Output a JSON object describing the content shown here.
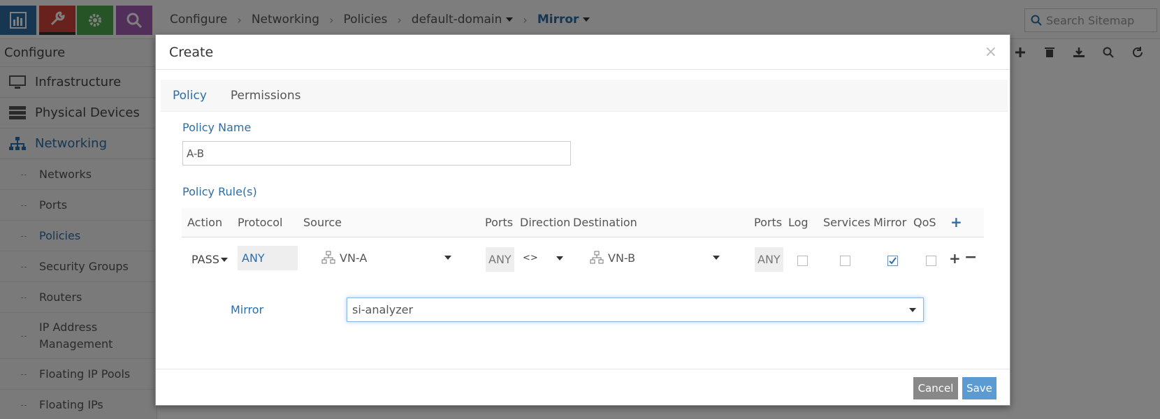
{
  "breadcrumb": {
    "items": [
      "Configure",
      "Networking",
      "Policies"
    ],
    "domain": "default-domain",
    "current": "Mirror"
  },
  "search": {
    "placeholder": "Search Sitemap"
  },
  "sidebar": {
    "title": "Configure",
    "main": [
      {
        "label": "Infrastructure",
        "icon": "monitor-icon"
      },
      {
        "label": "Physical Devices",
        "icon": "server-rack-icon"
      },
      {
        "label": "Networking",
        "icon": "network-tree-icon"
      }
    ],
    "sub": [
      "Networks",
      "Ports",
      "Policies",
      "Security Groups",
      "Routers",
      "IP Address Management",
      "Floating IP Pools",
      "Floating IPs"
    ],
    "selected_sub": "Policies"
  },
  "modal": {
    "title": "Create",
    "close": "×",
    "tabs": [
      "Policy",
      "Permissions"
    ],
    "active_tab": "Policy",
    "policy_name_label": "Policy Name",
    "policy_name_value": "A-B",
    "rules_label": "Policy Rule(s)",
    "columns": [
      "Action",
      "Protocol",
      "Source",
      "Ports",
      "Direction",
      "Destination",
      "Ports",
      "Log",
      "Services",
      "Mirror",
      "QoS"
    ],
    "rule": {
      "action": "PASS",
      "protocol": "ANY",
      "source": "VN-A",
      "source_ports": "ANY",
      "direction": "<>",
      "destination": "VN-B",
      "dest_ports": "ANY",
      "log": false,
      "services": false,
      "mirror": true,
      "qos": false
    },
    "mirror_label": "Mirror",
    "mirror_value": "si-analyzer",
    "cancel": "Cancel",
    "save": "Save"
  },
  "colors": {
    "accent": "#2b6ea8",
    "save": "#5b9bd1",
    "cancel": "#888888"
  }
}
